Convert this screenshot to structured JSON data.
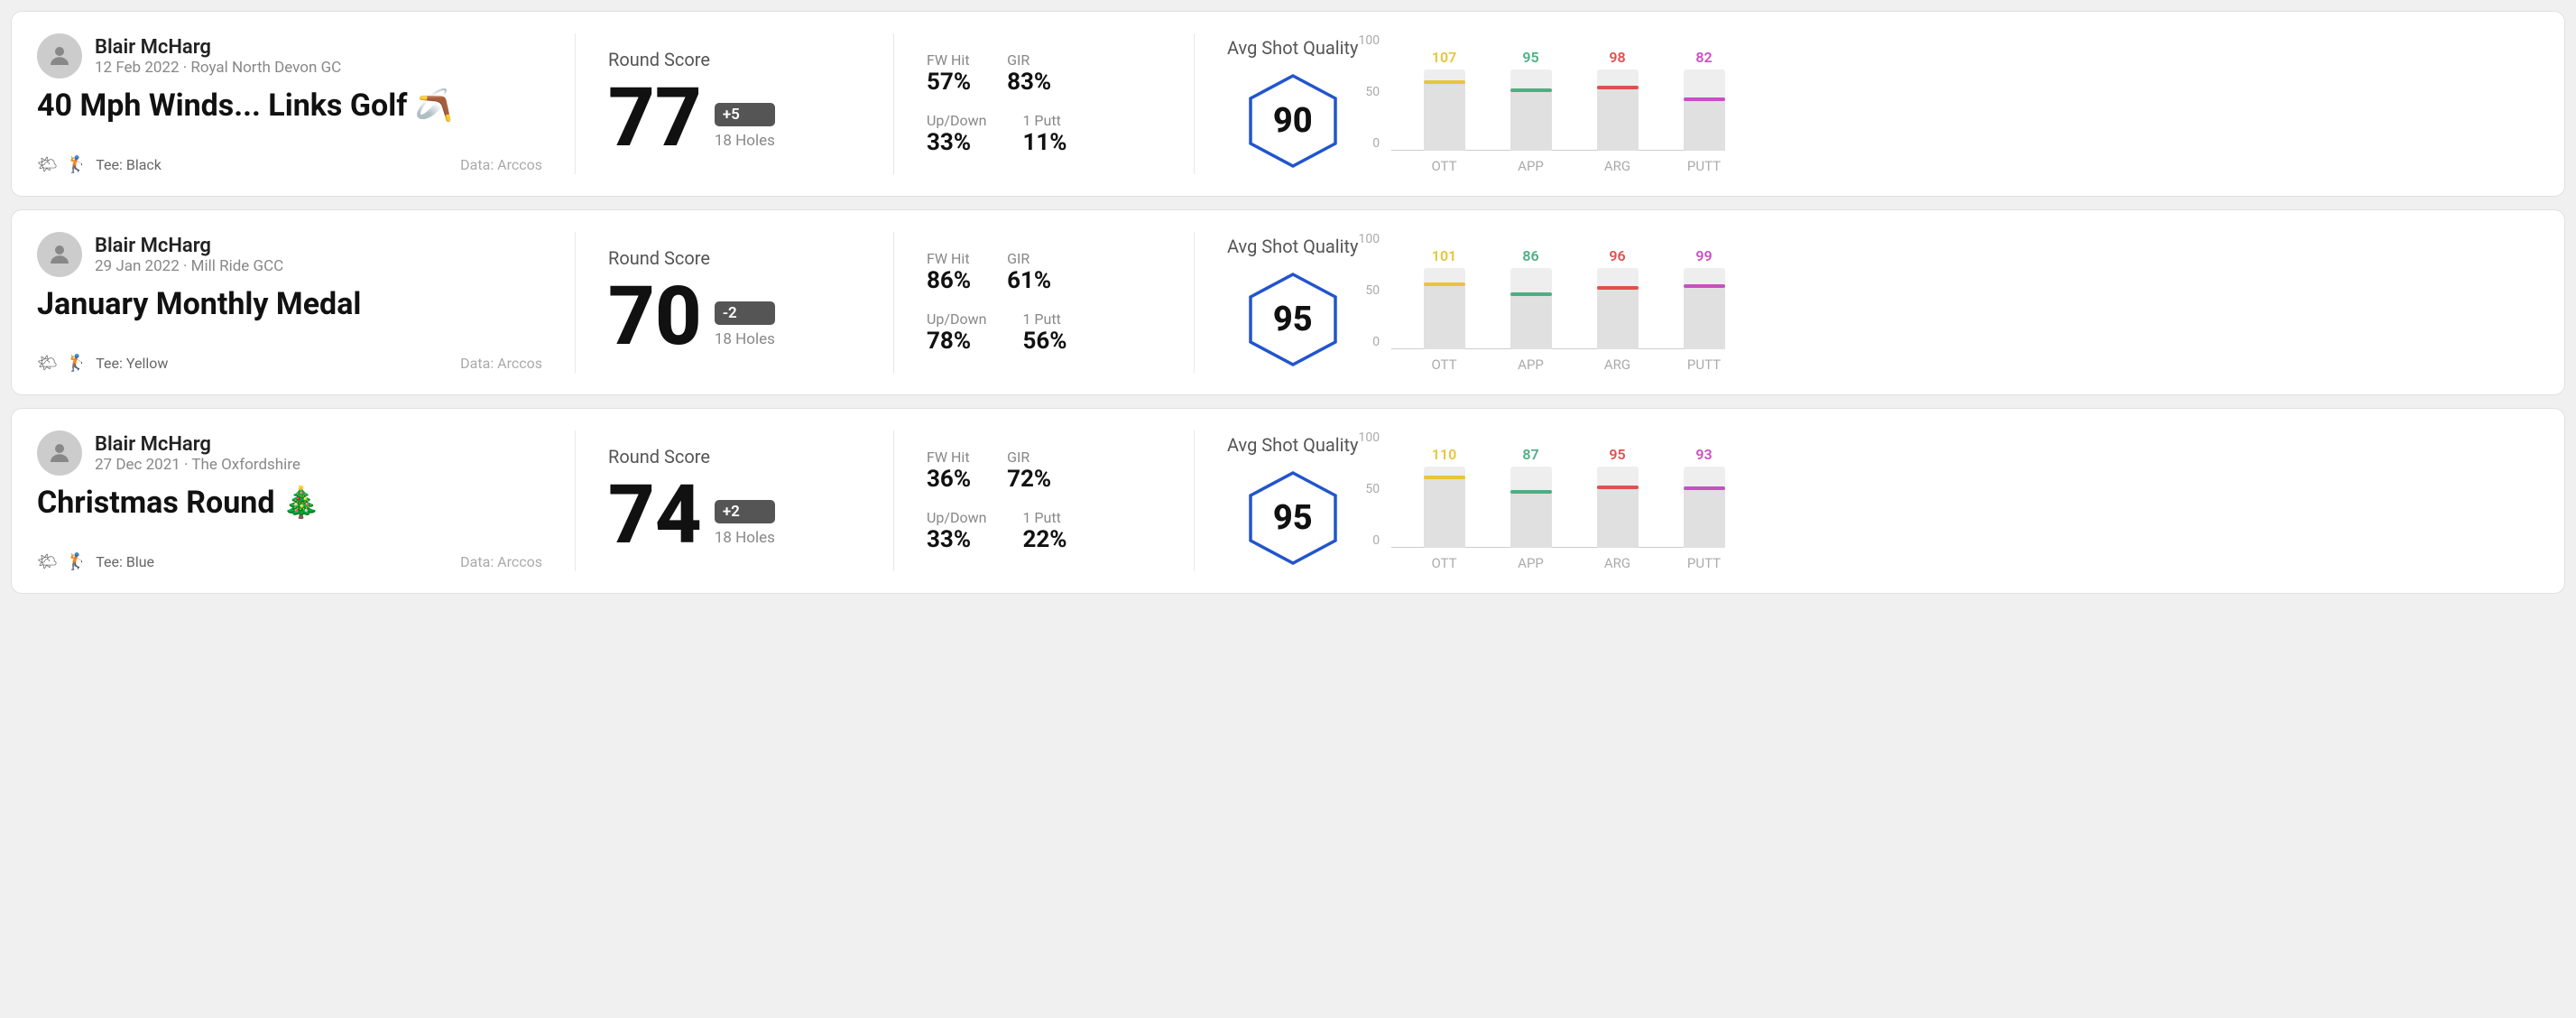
{
  "rounds": [
    {
      "player_name": "Blair McHarg",
      "date": "12 Feb 2022 · Royal North Devon GC",
      "title": "40 Mph Winds... Links Golf 🪃",
      "tee": "Black",
      "data_source": "Data: Arccos",
      "round_score_label": "Round Score",
      "score": "77",
      "score_diff": "+5",
      "holes": "18 Holes",
      "fw_hit_label": "FW Hit",
      "fw_hit": "57%",
      "gir_label": "GIR",
      "gir": "83%",
      "updown_label": "Up/Down",
      "updown": "33%",
      "oneputt_label": "1 Putt",
      "oneputt": "11%",
      "avg_quality_label": "Avg Shot Quality",
      "quality_score": "90",
      "chart": {
        "bars": [
          {
            "label": "OTT",
            "value": 107,
            "color": "ott",
            "height_pct": 87
          },
          {
            "label": "APP",
            "value": 95,
            "color": "app",
            "height_pct": 77
          },
          {
            "label": "ARG",
            "value": 98,
            "color": "arg",
            "height_pct": 80
          },
          {
            "label": "PUTT",
            "value": 82,
            "color": "putt",
            "height_pct": 66
          }
        ],
        "y_labels": [
          "100",
          "50",
          "0"
        ]
      }
    },
    {
      "player_name": "Blair McHarg",
      "date": "29 Jan 2022 · Mill Ride GCC",
      "title": "January Monthly Medal",
      "tee": "Yellow",
      "data_source": "Data: Arccos",
      "round_score_label": "Round Score",
      "score": "70",
      "score_diff": "-2",
      "holes": "18 Holes",
      "fw_hit_label": "FW Hit",
      "fw_hit": "86%",
      "gir_label": "GIR",
      "gir": "61%",
      "updown_label": "Up/Down",
      "updown": "78%",
      "oneputt_label": "1 Putt",
      "oneputt": "56%",
      "avg_quality_label": "Avg Shot Quality",
      "quality_score": "95",
      "chart": {
        "bars": [
          {
            "label": "OTT",
            "value": 101,
            "color": "ott",
            "height_pct": 82
          },
          {
            "label": "APP",
            "value": 86,
            "color": "app",
            "height_pct": 70
          },
          {
            "label": "ARG",
            "value": 96,
            "color": "arg",
            "height_pct": 78
          },
          {
            "label": "PUTT",
            "value": 99,
            "color": "putt",
            "height_pct": 80
          }
        ],
        "y_labels": [
          "100",
          "50",
          "0"
        ]
      }
    },
    {
      "player_name": "Blair McHarg",
      "date": "27 Dec 2021 · The Oxfordshire",
      "title": "Christmas Round 🎄",
      "tee": "Blue",
      "data_source": "Data: Arccos",
      "round_score_label": "Round Score",
      "score": "74",
      "score_diff": "+2",
      "holes": "18 Holes",
      "fw_hit_label": "FW Hit",
      "fw_hit": "36%",
      "gir_label": "GIR",
      "gir": "72%",
      "updown_label": "Up/Down",
      "updown": "33%",
      "oneputt_label": "1 Putt",
      "oneputt": "22%",
      "avg_quality_label": "Avg Shot Quality",
      "quality_score": "95",
      "chart": {
        "bars": [
          {
            "label": "OTT",
            "value": 110,
            "color": "ott",
            "height_pct": 89
          },
          {
            "label": "APP",
            "value": 87,
            "color": "app",
            "height_pct": 71
          },
          {
            "label": "ARG",
            "value": 95,
            "color": "arg",
            "height_pct": 77
          },
          {
            "label": "PUTT",
            "value": 93,
            "color": "putt",
            "height_pct": 75
          }
        ],
        "y_labels": [
          "100",
          "50",
          "0"
        ]
      }
    }
  ]
}
